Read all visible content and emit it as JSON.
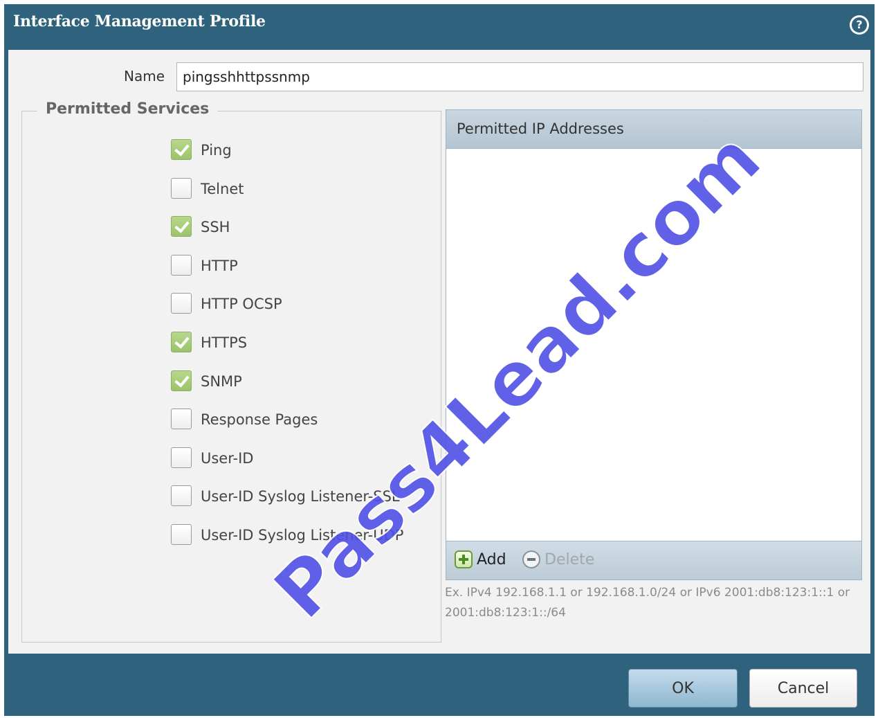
{
  "dialog": {
    "title": "Interface Management Profile",
    "help_glyph": "?"
  },
  "name_field": {
    "label": "Name",
    "value": "pingsshhttpssnmp"
  },
  "permitted_services": {
    "legend": "Permitted Services",
    "items": [
      {
        "label": "Ping",
        "checked": true
      },
      {
        "label": "Telnet",
        "checked": false
      },
      {
        "label": "SSH",
        "checked": true
      },
      {
        "label": "HTTP",
        "checked": false
      },
      {
        "label": "HTTP OCSP",
        "checked": false
      },
      {
        "label": "HTTPS",
        "checked": true
      },
      {
        "label": "SNMP",
        "checked": true
      },
      {
        "label": "Response Pages",
        "checked": false
      },
      {
        "label": "User-ID",
        "checked": false
      },
      {
        "label": "User-ID Syslog Listener-SSL",
        "checked": false
      },
      {
        "label": "User-ID Syslog Listener-UDP",
        "checked": false
      }
    ]
  },
  "permitted_ip": {
    "header": "Permitted IP Addresses",
    "add_label": "Add",
    "delete_label": "Delete",
    "hint": "Ex. IPv4 192.168.1.1 or 192.168.1.0/24 or IPv6 2001:db8:123:1::1 or 2001:db8:123:1::/64"
  },
  "footer": {
    "ok_label": "OK",
    "cancel_label": "Cancel"
  },
  "watermark": "Pass4Lead.com",
  "colors": {
    "title_bar": "#2f627d",
    "checked": "#9cc36a",
    "panel_header": "#b3c5d2",
    "watermark": "#5050e6"
  }
}
